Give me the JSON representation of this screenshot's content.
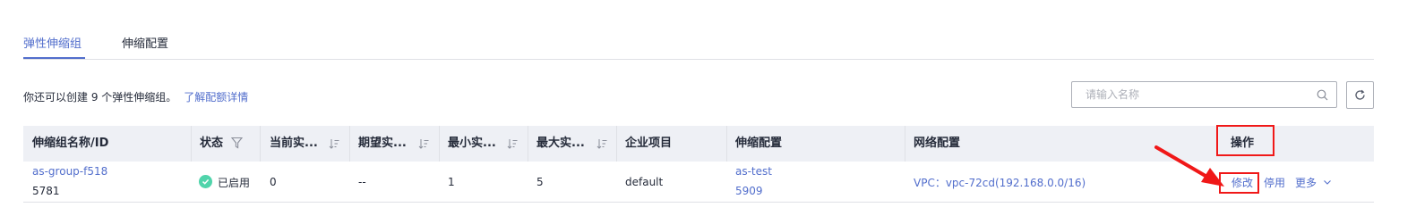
{
  "tabs": [
    {
      "label": "弹性伸缩组",
      "active": true
    },
    {
      "label": "伸缩配置",
      "active": false
    }
  ],
  "quota": {
    "text": "你还可以创建 9 个弹性伸缩组。",
    "link": "了解配额详情"
  },
  "search": {
    "placeholder": "请输入名称",
    "icon": "search-icon"
  },
  "refresh": {
    "icon": "refresh-icon"
  },
  "table": {
    "headers": {
      "name": "伸缩组名称/ID",
      "status": "状态",
      "current": "当前实...",
      "desired": "期望实...",
      "min": "最小实...",
      "max": "最大实...",
      "project": "企业项目",
      "config": "伸缩配置",
      "network": "网络配置",
      "actions": "操作"
    },
    "rows": [
      {
        "name": "as-group-f518",
        "id": "5781",
        "status": "已启用",
        "current": "0",
        "desired": "--",
        "min": "1",
        "max": "5",
        "project": "default",
        "config_name": "as-test",
        "config_id": "5909",
        "network": "VPC：vpc-72cd(192.168.0.0/16)",
        "actions": {
          "edit": "修改",
          "stop": "停用",
          "more": "更多"
        }
      }
    ]
  },
  "colors": {
    "accent": "#526ecc",
    "header_bg": "#eef0f5",
    "status_ok": "#50d4ab",
    "annotation": "#f01818"
  }
}
